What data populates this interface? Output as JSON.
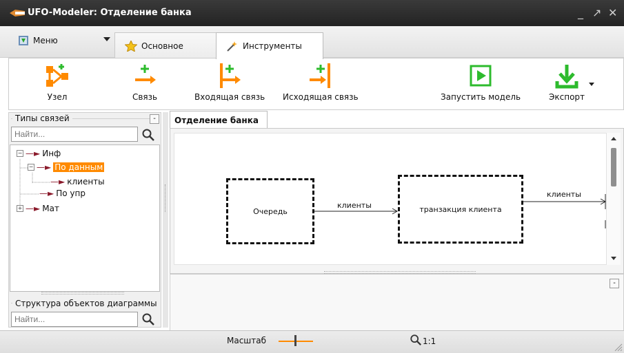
{
  "window": {
    "title": "UFO-Modeler: Отделение банка"
  },
  "menu": {
    "label": "Меню"
  },
  "tabs": [
    {
      "label": "Основное"
    },
    {
      "label": "Инструменты"
    }
  ],
  "toolbar": {
    "node": "Узел",
    "link": "Связь",
    "incoming": "Входящая связь",
    "outgoing": "Исходящая связь",
    "run": "Запустить модель",
    "export": "Экспорт"
  },
  "left_panel": {
    "link_types_title": "Типы связей",
    "search_placeholder": "Найти...",
    "tree": {
      "inf": "Инф",
      "by_data": "По данным",
      "clients": "клиенты",
      "by_control": "По упр",
      "mat": "Мат"
    },
    "structure_title": "Структура объектов диаграммы",
    "structure_search_placeholder": "Найти..."
  },
  "document": {
    "tab_title": "Отделение банка",
    "nodes": {
      "queue": "Очередь",
      "transaction": "транзакция клиента"
    },
    "links": {
      "link1": "клиенты",
      "link2": "клиенты"
    }
  },
  "status": {
    "scale_label": "Масштаб",
    "zoom_text": "1:1"
  },
  "colors": {
    "accent": "#ff8a00",
    "green": "#2dbb2d",
    "link": "#8b1a2b"
  }
}
